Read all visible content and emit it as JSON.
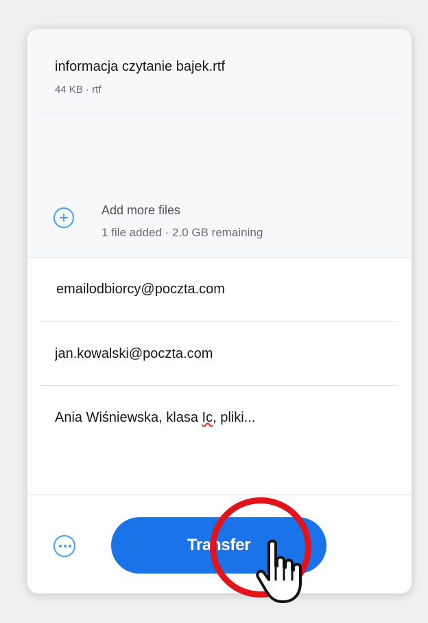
{
  "file": {
    "name": "informacja czytanie bajek.rtf",
    "meta": "44 KB · rtf"
  },
  "add_files": {
    "title": "Add more files",
    "status": "1 file added · 2.0 GB remaining",
    "icon": "plus-circle-icon"
  },
  "form": {
    "recipient_email": "emailodbiorcy@poczta.com",
    "sender_email": "jan.kowalski@poczta.com",
    "message_before": "Ania Wiśniewska, klasa ",
    "message_misspelled": "Ic",
    "message_after": ", pliki..."
  },
  "footer": {
    "transfer_label": "Transfer",
    "more_icon": "more-options-icon"
  },
  "colors": {
    "accent": "#409fff",
    "button": "#1a73e8",
    "annotation": "#e3131b"
  }
}
